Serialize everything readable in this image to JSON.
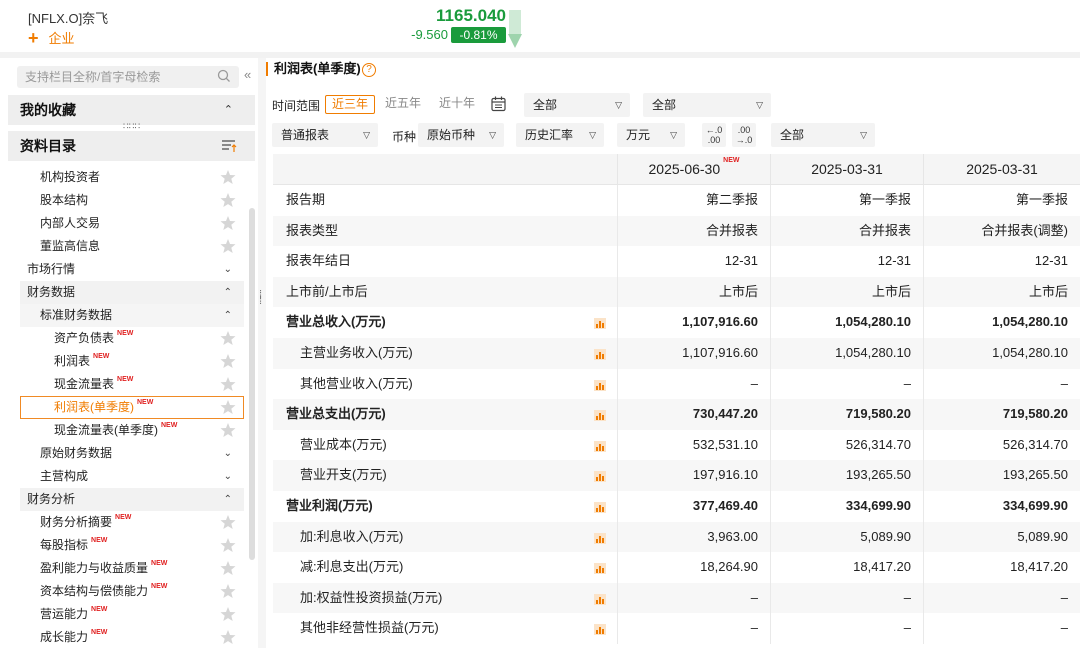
{
  "header": {
    "ticker": "[NFLX.O]奈飞",
    "add_label": "企业",
    "price": "1165.040",
    "change": "-9.560",
    "change_pct": "-0.81%",
    "price_color": "#1a9b3c"
  },
  "sidebar": {
    "search_placeholder": "支持栏目全称/首字母检索",
    "collapse_icon": "double-chevron-left-icon",
    "favorites_label": "我的收藏",
    "catalog_label": "资料目录",
    "tree": [
      {
        "label": "机构投资者",
        "type": "l1",
        "star": true
      },
      {
        "label": "股本结构",
        "type": "l1",
        "star": true
      },
      {
        "label": "内部人交易",
        "type": "l1",
        "star": true
      },
      {
        "label": "董监高信息",
        "type": "l1",
        "star": true
      },
      {
        "label": "市场行情",
        "type": "plain",
        "chev": "⌄"
      },
      {
        "label": "财务数据",
        "type": "grp",
        "chev": "⌃"
      },
      {
        "label": "标准财务数据",
        "type": "grp2",
        "chev": "⌃"
      },
      {
        "label": "资产负债表",
        "type": "l2",
        "star": true,
        "new": "NEW"
      },
      {
        "label": "利润表",
        "type": "l2",
        "star": true,
        "new": "NEW"
      },
      {
        "label": "现金流量表",
        "type": "l2",
        "star": true,
        "new": "NEW"
      },
      {
        "label": "利润表(单季度)",
        "type": "l2",
        "star": true,
        "new": "NEW",
        "selected": true
      },
      {
        "label": "现金流量表(单季度)",
        "type": "l2",
        "star": true,
        "new": "NEW"
      },
      {
        "label": "原始财务数据",
        "type": "l1",
        "chev": "⌄"
      },
      {
        "label": "主营构成",
        "type": "l1",
        "chev": "⌄"
      },
      {
        "label": "财务分析",
        "type": "grp",
        "chev": "⌃"
      },
      {
        "label": "财务分析摘要",
        "type": "l1",
        "star": true,
        "new": "NEW"
      },
      {
        "label": "每股指标",
        "type": "l1",
        "star": true,
        "new": "NEW"
      },
      {
        "label": "盈利能力与收益质量",
        "type": "l1",
        "star": true,
        "new": "NEW"
      },
      {
        "label": "资本结构与偿债能力",
        "type": "l1",
        "star": true,
        "new": "NEW"
      },
      {
        "label": "营运能力",
        "type": "l1",
        "star": true,
        "new": "NEW"
      },
      {
        "label": "成长能力",
        "type": "l1",
        "star": true,
        "new": "NEW"
      }
    ]
  },
  "main": {
    "title": "利润表(单季度)",
    "help_icon": "question-icon",
    "time_range_label": "时间范围",
    "time_tabs": [
      "近三年",
      "近五年",
      "近十年"
    ],
    "dd_all_1": "全部",
    "dd_all_2": "全部",
    "report_type": "普通报表",
    "currency_label": "币种",
    "currency": "原始币种",
    "rate": "历史汇率",
    "unit": "万元",
    "dec_minus_top": "←.0",
    "dec_minus_bottom": ".00",
    "dec_plus_top": ".00",
    "dec_plus_bottom": "→.0",
    "dd_all_3": "全部"
  },
  "table": {
    "headers": [
      "2025-06-30",
      "2025-03-31",
      "2025-03-31"
    ],
    "header_new": "NEW",
    "rows": [
      {
        "name": "报告期",
        "v": [
          "第二季报",
          "第一季报",
          "第一季报"
        ]
      },
      {
        "name": "报表类型",
        "v": [
          "合并报表",
          "合并报表",
          "合并报表(调整)"
        ]
      },
      {
        "name": "报表年结日",
        "v": [
          "12-31",
          "12-31",
          "12-31"
        ]
      },
      {
        "name": "上市前/上市后",
        "v": [
          "上市后",
          "上市后",
          "上市后"
        ]
      },
      {
        "name": "营业总收入(万元)",
        "v": [
          "1,107,916.60",
          "1,054,280.10",
          "1,054,280.10"
        ],
        "bold": true,
        "chart": true
      },
      {
        "name": "主营业务收入(万元)",
        "v": [
          "1,107,916.60",
          "1,054,280.10",
          "1,054,280.10"
        ],
        "sub": true,
        "chart": true
      },
      {
        "name": "其他营业收入(万元)",
        "v": [
          "–",
          "–",
          "–"
        ],
        "sub": true,
        "chart": true
      },
      {
        "name": "营业总支出(万元)",
        "v": [
          "730,447.20",
          "719,580.20",
          "719,580.20"
        ],
        "bold": true,
        "chart": true
      },
      {
        "name": "营业成本(万元)",
        "v": [
          "532,531.10",
          "526,314.70",
          "526,314.70"
        ],
        "sub": true,
        "chart": true
      },
      {
        "name": "营业开支(万元)",
        "v": [
          "197,916.10",
          "193,265.50",
          "193,265.50"
        ],
        "sub": true,
        "chart": true
      },
      {
        "name": "营业利润(万元)",
        "v": [
          "377,469.40",
          "334,699.90",
          "334,699.90"
        ],
        "bold": true,
        "chart": true
      },
      {
        "name": "加:利息收入(万元)",
        "v": [
          "3,963.00",
          "5,089.90",
          "5,089.90"
        ],
        "sub": true,
        "chart": true
      },
      {
        "name": "减:利息支出(万元)",
        "v": [
          "18,264.90",
          "18,417.20",
          "18,417.20"
        ],
        "sub": true,
        "chart": true
      },
      {
        "name": "加:权益性投资损益(万元)",
        "v": [
          "–",
          "–",
          "–"
        ],
        "sub": true,
        "chart": true
      },
      {
        "name": "其他非经营性损益(万元)",
        "v": [
          "–",
          "–",
          "–"
        ],
        "sub": true,
        "chart": true
      }
    ]
  }
}
